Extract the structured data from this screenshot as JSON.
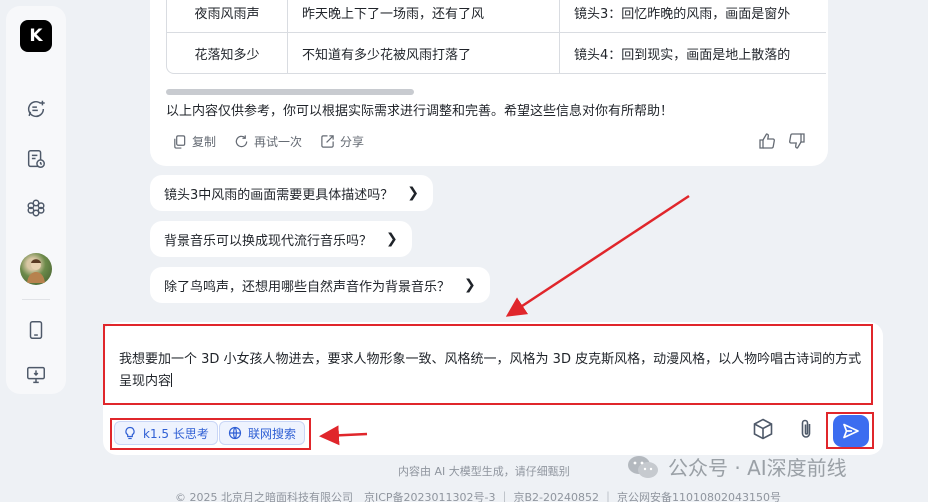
{
  "sidebar": {
    "logo_text": "K",
    "icons": [
      "new-chat-icon",
      "history-icon",
      "explore-icon",
      "avatar",
      "phone-icon",
      "desktop-icon"
    ]
  },
  "table": {
    "rows": [
      [
        "夜雨风雨声",
        "昨天晚上下了一场雨，还有了风",
        "镜头3：回忆昨晚的风雨，画面是窗外"
      ],
      [
        "花落知多少",
        "不知道有多少花被风雨打落了",
        "镜头4：回到现实，画面是地上散落的"
      ]
    ]
  },
  "response": {
    "note": "以上内容仅供参考，你可以根据实际需求进行调整和完善。希望这些信息对你有所帮助！",
    "actions": {
      "copy": "复制",
      "retry": "再试一次",
      "share": "分享"
    }
  },
  "suggestions": [
    "镜头3中风雨的画面需要更具体描述吗？",
    "背景音乐可以换成现代流行音乐吗？",
    "除了鸟鸣声，还想用哪些自然声音作为背景音乐？"
  ],
  "input": {
    "value": "我想要加一个 3D 小女孩人物进去，要求人物形象一致、风格统一，风格为 3D 皮克斯风格，动漫风格，以人物吟唱古诗词的方式呈现内容",
    "chips": {
      "long_think": "k1.5 长思考",
      "web_search": "联网搜索"
    }
  },
  "footer": {
    "disclaimer": "内容由 AI 大模型生成，请仔细甄别",
    "copyright": "© 2025 北京月之暗面科技有限公司　京ICP备2023011302号-3 ｜ 京B2-20240852 ｜ 京公网安备11010802043150号"
  },
  "watermark": "公众号 · AI深度前线",
  "colors": {
    "annotation_red": "#e0262b",
    "accent_blue": "#3c6df0",
    "background": "#eef1f5"
  }
}
